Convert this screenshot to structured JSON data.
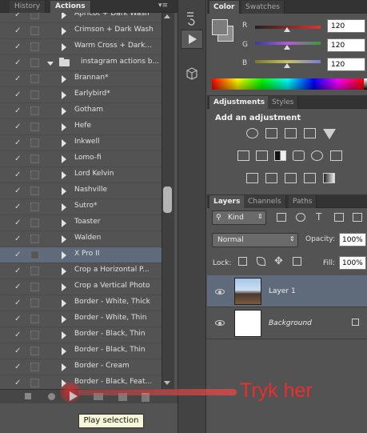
{
  "actions_panel": {
    "tabs": [
      "History",
      "Actions"
    ],
    "rows": [
      {
        "label": "Apricot + Dark Wash",
        "type": "action"
      },
      {
        "label": "Crimson + Dark Wash",
        "type": "action"
      },
      {
        "label": "Warm Cross + Dark...",
        "type": "action"
      },
      {
        "label": "instagram actions b...",
        "type": "set"
      },
      {
        "label": "Brannan*",
        "type": "action"
      },
      {
        "label": "Earlybird*",
        "type": "action"
      },
      {
        "label": "Gotham",
        "type": "action"
      },
      {
        "label": "Hefe",
        "type": "action"
      },
      {
        "label": "Inkwell",
        "type": "action"
      },
      {
        "label": "Lomo-fi",
        "type": "action"
      },
      {
        "label": "Lord Kelvin",
        "type": "action"
      },
      {
        "label": "Nashville",
        "type": "action"
      },
      {
        "label": "Sutro*",
        "type": "action"
      },
      {
        "label": "Toaster",
        "type": "action"
      },
      {
        "label": "Walden",
        "type": "action"
      },
      {
        "label": "X Pro II",
        "type": "action",
        "selected": true
      },
      {
        "label": "Crop a Horizontal P...",
        "type": "action"
      },
      {
        "label": "Crop a Vertical Photo",
        "type": "action"
      },
      {
        "label": "Border - White, Thick",
        "type": "action"
      },
      {
        "label": "Border - White, Thin",
        "type": "action"
      },
      {
        "label": "Border - Black, Thin",
        "type": "action"
      },
      {
        "label": "Border - Black, Thin",
        "type": "action"
      },
      {
        "label": "Border - Cream",
        "type": "action"
      },
      {
        "label": "Border - Black, Feat...",
        "type": "action"
      }
    ],
    "tooltip": "Play selection"
  },
  "color_panel": {
    "tabs": [
      "Color",
      "Swatches"
    ],
    "channels": [
      {
        "name": "R",
        "value": "120",
        "slider_color": "#d45a5a"
      },
      {
        "name": "G",
        "value": "120",
        "slider_color": "#b35ad4"
      },
      {
        "name": "B",
        "value": "120",
        "slider_color": "#c7c45a"
      }
    ]
  },
  "adjustments_panel": {
    "tabs": [
      "Adjustments",
      "Styles"
    ],
    "title": "Add an adjustment"
  },
  "layers_panel": {
    "tabs": [
      "Layers",
      "Channels",
      "Paths"
    ],
    "filter_label": "Kind",
    "blend_mode": "Normal",
    "opacity_label": "Opacity:",
    "opacity_value": "100%",
    "lock_label": "Lock:",
    "fill_label": "Fill:",
    "fill_value": "100%",
    "layers": [
      {
        "name": "Layer 1",
        "selected": true
      },
      {
        "name": "Background",
        "italic": true
      }
    ]
  },
  "annotation": {
    "text": "Tryk her",
    "color": "#ec2d2d"
  }
}
